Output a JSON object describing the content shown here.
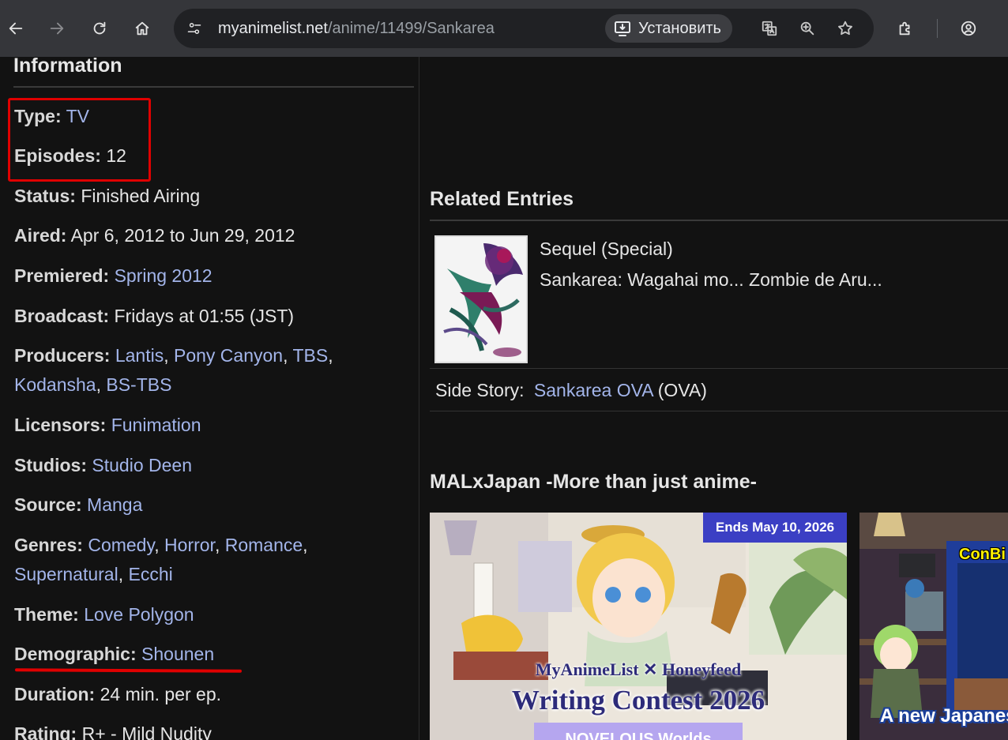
{
  "browser": {
    "url_host": "myanimelist.net",
    "url_path": "/anime/11499/Sankarea",
    "install_label": "Установить"
  },
  "information": {
    "title": "Information",
    "rows": {
      "type": {
        "label": "Type:",
        "value": "TV"
      },
      "episodes": {
        "label": "Episodes:",
        "value": "12"
      },
      "status": {
        "label": "Status:",
        "value": "Finished Airing"
      },
      "aired": {
        "label": "Aired:",
        "value": "Apr 6, 2012 to Jun 29, 2012"
      },
      "premiered": {
        "label": "Premiered:",
        "value": "Spring 2012"
      },
      "broadcast": {
        "label": "Broadcast:",
        "value": "Fridays at 01:55 (JST)"
      },
      "producers": {
        "label": "Producers:",
        "items": [
          "Lantis",
          "Pony Canyon",
          "TBS",
          "Kodansha",
          "BS-TBS"
        ]
      },
      "licensors": {
        "label": "Licensors:",
        "value": "Funimation"
      },
      "studios": {
        "label": "Studios:",
        "value": "Studio Deen"
      },
      "source": {
        "label": "Source:",
        "value": "Manga"
      },
      "genres": {
        "label": "Genres:",
        "items": [
          "Comedy",
          "Horror",
          "Romance",
          "Supernatural",
          "Ecchi"
        ]
      },
      "theme": {
        "label": "Theme:",
        "value": "Love Polygon"
      },
      "demographic": {
        "label": "Demographic:",
        "value": "Shounen"
      },
      "duration": {
        "label": "Duration:",
        "value": "24 min. per ep."
      },
      "rating": {
        "label": "Rating:",
        "value": "R+ - Mild Nudity"
      }
    },
    "separator": ","
  },
  "related": {
    "title": "Related Entries",
    "sequel_relation": "Sequel (Special)",
    "sequel_title": "Sankarea: Wagahai mo... Zombie de Aru...",
    "side_story_label": "Side Story:",
    "side_story_title": "Sankarea OVA",
    "side_story_type": "(OVA)"
  },
  "malxjapan": {
    "title": "MALxJapan -More than just anime-",
    "banner1": {
      "badge": "Ends May 10, 2026",
      "top_line": "MyAnimeList ✕ Honeyfeed",
      "main_line": "Writing Contest 2026",
      "bottom_line": "NOVELOUS Worlds"
    },
    "banner2": {
      "top_line": "ConBi",
      "bottom_line": "A new Japanes"
    }
  },
  "colors": {
    "link": "#a3b5ea",
    "annotation": "#e00000",
    "background": "#121212"
  }
}
